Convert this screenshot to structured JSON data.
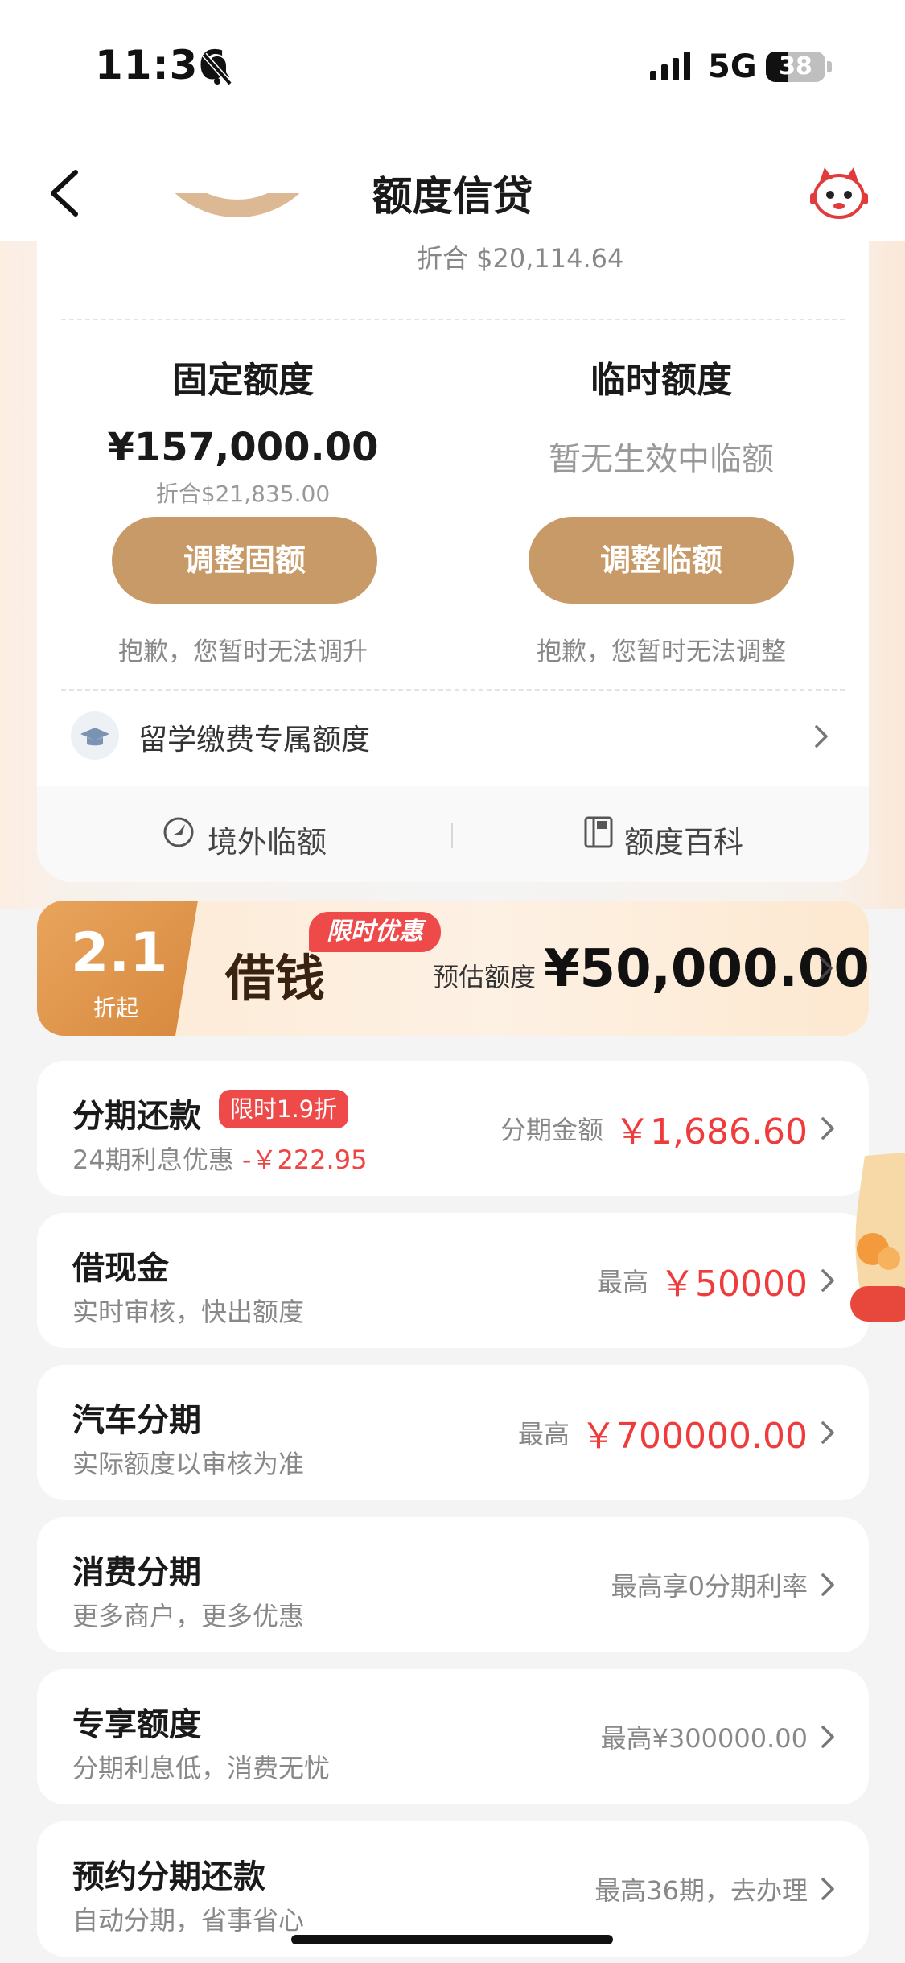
{
  "status_bar": {
    "time": "11:36",
    "network": "5G",
    "battery": "38"
  },
  "nav": {
    "title": "额度信贷"
  },
  "summary": {
    "converted": "折合 $20,114.64"
  },
  "fixed_limit": {
    "title": "固定额度",
    "amount": "¥157,000.00",
    "converted": "折合$21,835.00",
    "button": "调整固额",
    "note": "抱歉，您暂时无法调升"
  },
  "temp_limit": {
    "title": "临时额度",
    "status": "暂无生效中临额",
    "button": "调整临额",
    "note": "抱歉，您暂时无法调整"
  },
  "study_abroad": {
    "label": "留学缴费专属额度"
  },
  "quick_links": {
    "overseas": "境外临额",
    "encyclopedia": "额度百科"
  },
  "promo": {
    "discount": "2.1",
    "discount_label": "折起",
    "title": "借钱",
    "tag": "限时优惠",
    "est_label": "预估额度",
    "est_amount": "¥50,000.00"
  },
  "rows": [
    {
      "title": "分期还款",
      "tag": "限时1.9折",
      "sub_prefix": "24期利息优惠",
      "sub_value": "-￥222.95",
      "right_label": "分期金额",
      "right_value": "￥1,686.60"
    },
    {
      "title": "借现金",
      "sub": "实时审核，快出额度",
      "right_label": "最高",
      "right_value": "￥50000"
    },
    {
      "title": "汽车分期",
      "sub": "实际额度以审核为准",
      "right_label": "最高",
      "right_value": "￥700000.00"
    },
    {
      "title": "消费分期",
      "sub": "更多商户，更多优惠",
      "right_text": "最高享0分期利率"
    },
    {
      "title": "专享额度",
      "sub": "分期利息低，消费无忧",
      "right_text": "最高¥300000.00"
    },
    {
      "title": "预约分期还款",
      "sub": "自动分期，省事省心",
      "right_text": "最高36期，去办理"
    }
  ],
  "colors": {
    "accent": "#c89a68",
    "price_red": "#ef3b3b",
    "tag_red": "#ef4a4a"
  }
}
